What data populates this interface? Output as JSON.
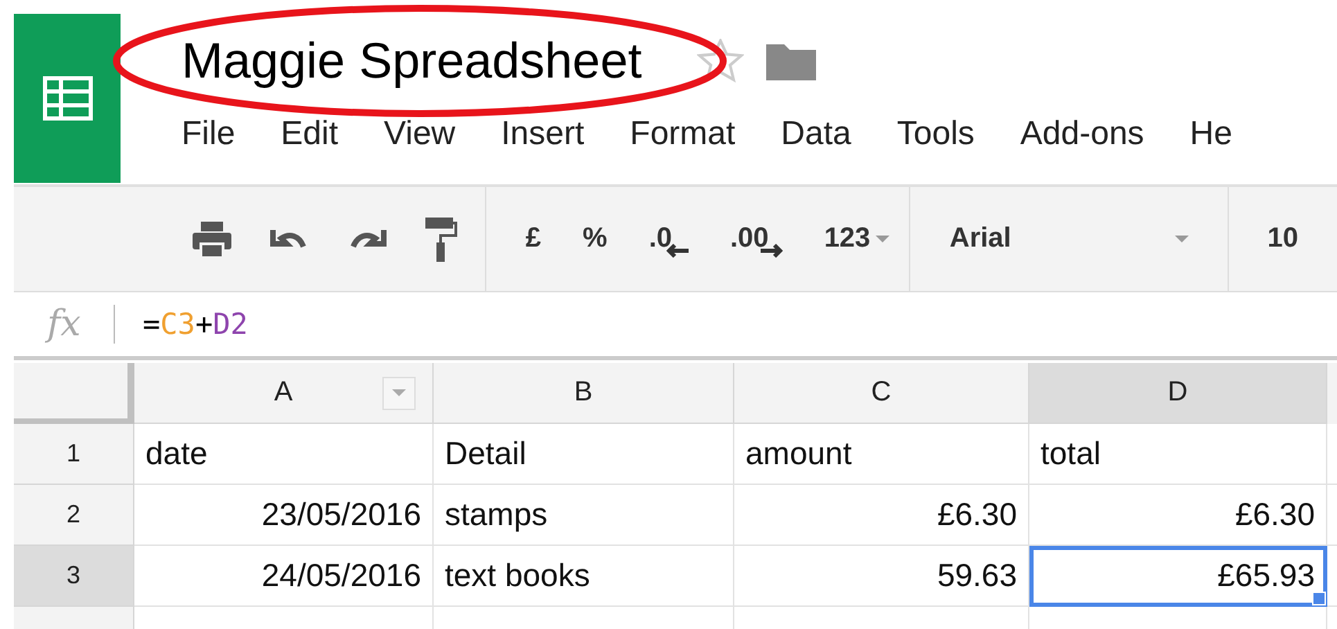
{
  "document": {
    "title": "Maggie Spreadsheet",
    "starred": false
  },
  "menu": [
    "File",
    "Edit",
    "View",
    "Insert",
    "Format",
    "Data",
    "Tools",
    "Add-ons",
    "He"
  ],
  "toolbar": {
    "currency": "£",
    "percent": "%",
    "decrease_decimals": ".0",
    "increase_decimals": ".00",
    "number_format": "123",
    "font": "Arial",
    "font_size": "10"
  },
  "formula_bar": {
    "function_label": "fx",
    "tokens": [
      {
        "text": "=",
        "color": "#000000"
      },
      {
        "text": "C3",
        "color": "#f0a030"
      },
      {
        "text": "+",
        "color": "#000000"
      },
      {
        "text": "D2",
        "color": "#8e44ad"
      }
    ]
  },
  "columns": [
    {
      "label": "A",
      "selected": false
    },
    {
      "label": "B",
      "selected": false
    },
    {
      "label": "C",
      "selected": false
    },
    {
      "label": "D",
      "selected": true
    }
  ],
  "rows": [
    {
      "number": "1",
      "selected": false,
      "cells": [
        {
          "text": "date",
          "kind": "text",
          "selected": false
        },
        {
          "text": "Detail",
          "kind": "text",
          "selected": false
        },
        {
          "text": "amount",
          "kind": "text",
          "selected": false
        },
        {
          "text": "total",
          "kind": "text",
          "selected": false
        }
      ]
    },
    {
      "number": "2",
      "selected": false,
      "cells": [
        {
          "text": "23/05/2016",
          "kind": "number",
          "selected": false
        },
        {
          "text": "stamps",
          "kind": "text",
          "selected": false
        },
        {
          "text": "£6.30",
          "kind": "number",
          "selected": false
        },
        {
          "text": "£6.30",
          "kind": "number",
          "selected": false
        }
      ]
    },
    {
      "number": "3",
      "selected": true,
      "cells": [
        {
          "text": "24/05/2016",
          "kind": "number",
          "selected": false
        },
        {
          "text": "text books",
          "kind": "text",
          "selected": false
        },
        {
          "text": "59.63",
          "kind": "number",
          "selected": false
        },
        {
          "text": "£65.93",
          "kind": "number",
          "selected": true
        }
      ]
    }
  ]
}
